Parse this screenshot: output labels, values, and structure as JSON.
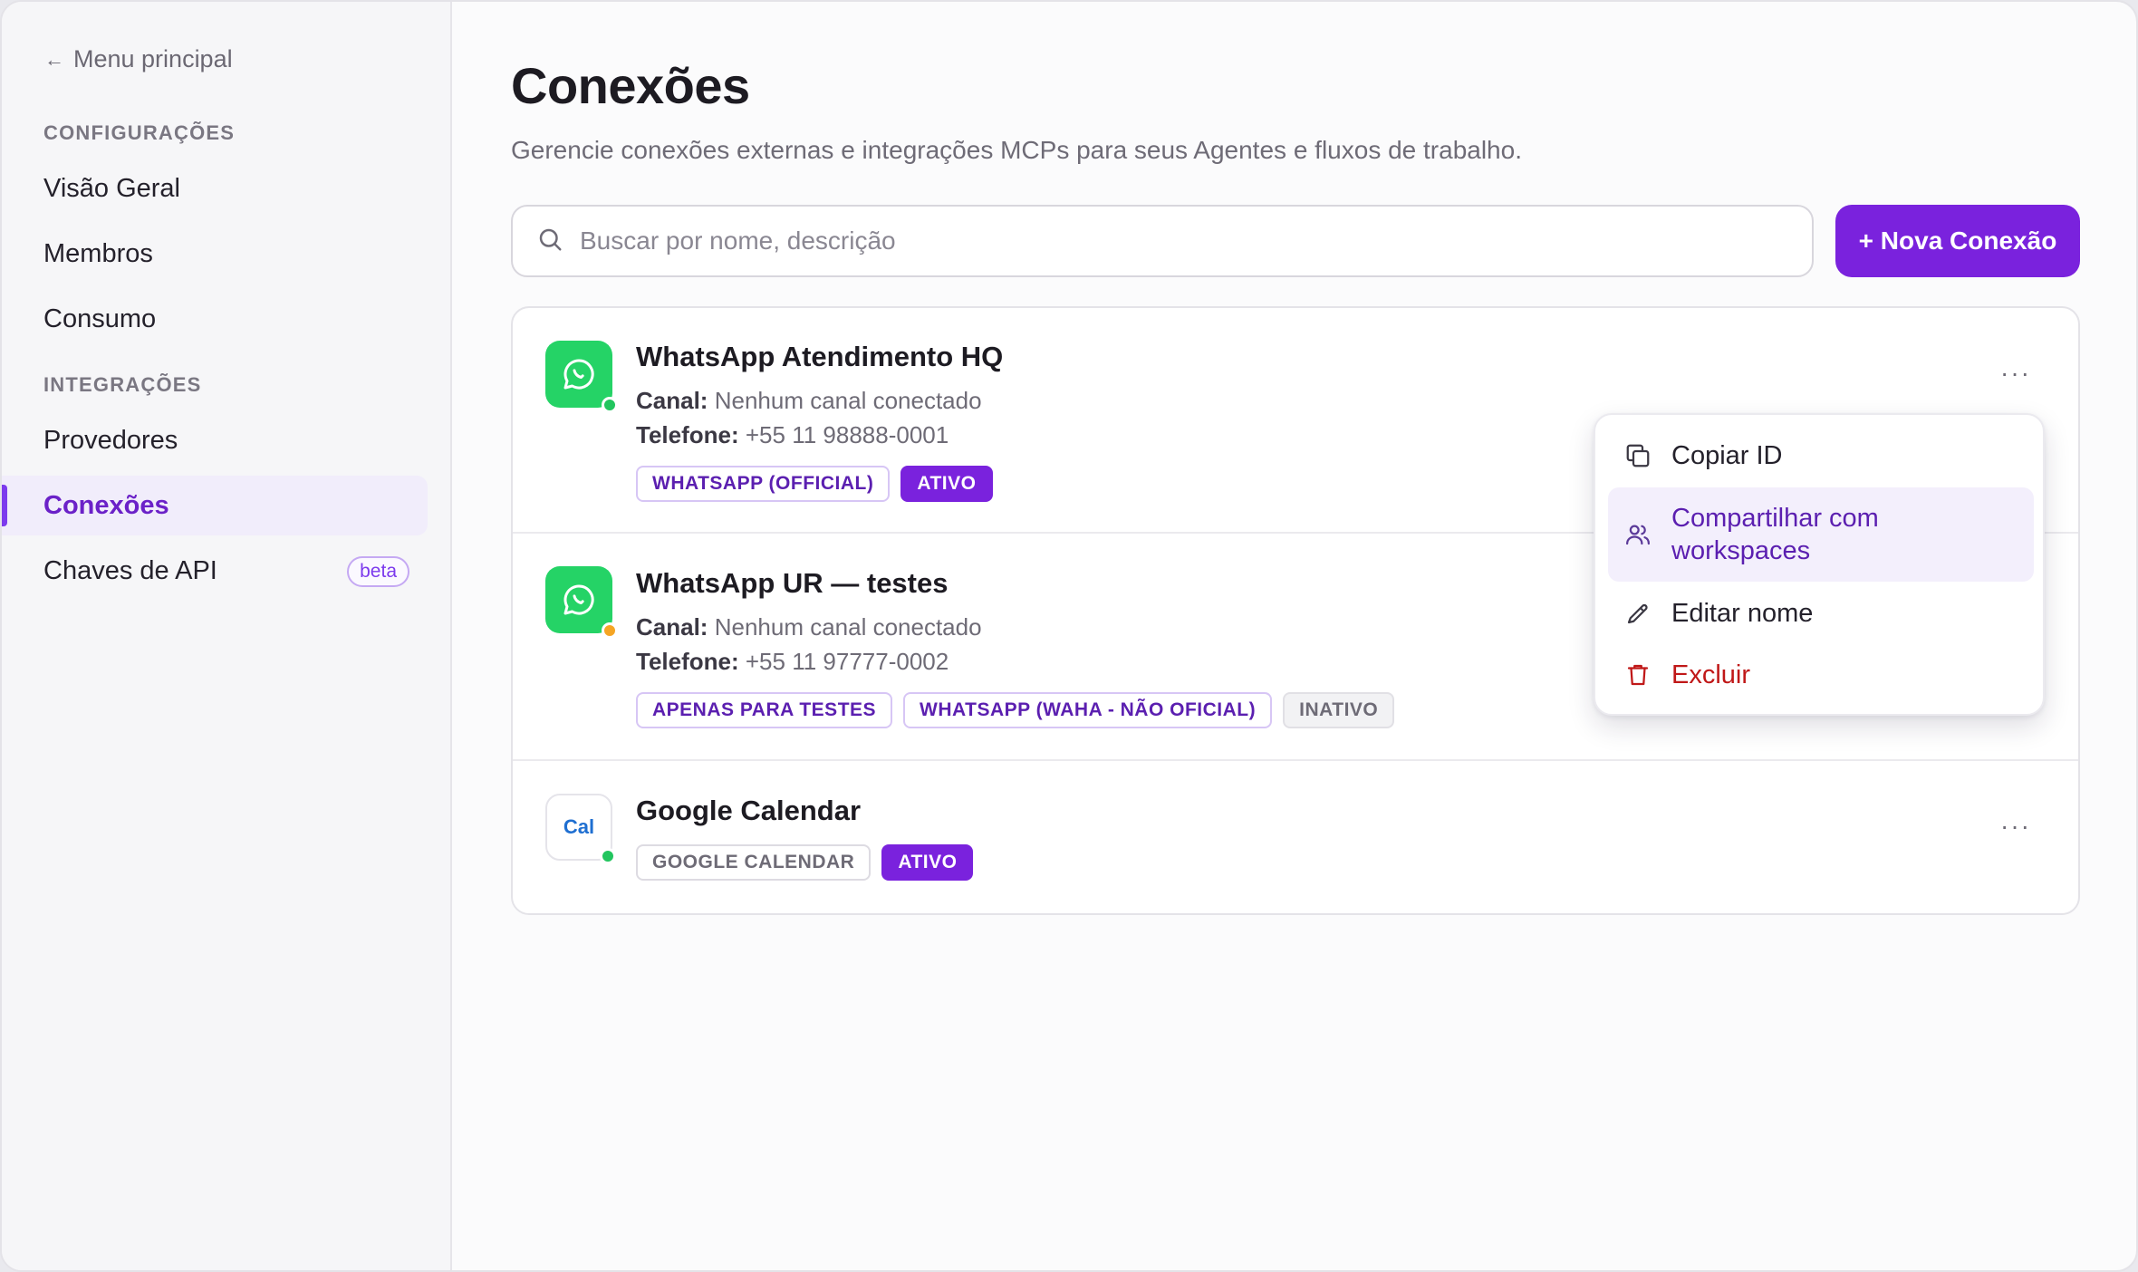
{
  "sidebar": {
    "back_label": "Menu principal",
    "section_config": "CONFIGURAÇÕES",
    "item_overview": "Visão Geral",
    "item_members": "Membros",
    "item_usage": "Consumo",
    "section_integrations": "INTEGRAÇÕES",
    "item_providers": "Provedores",
    "item_connections": "Conexões",
    "item_api_keys": "Chaves de API",
    "beta_badge": "beta"
  },
  "main": {
    "title": "Conexões",
    "subtitle": "Gerencie conexões externas e integrações MCPs para seus Agentes e fluxos de trabalho.",
    "search_placeholder": "Buscar por nome, descrição",
    "new_button": "+ Nova Conexão"
  },
  "connections": [
    {
      "name": "WhatsApp Atendimento HQ",
      "channel_label": "Canal:",
      "channel_value": "Nenhum canal conectado",
      "phone_label": "Telefone:",
      "phone_value": "+55 11 98888-0001",
      "tags": [
        "WHATSAPP (OFFICIAL)",
        "ATIVO"
      ],
      "status_color": "#22c55e"
    },
    {
      "name": "WhatsApp UR — testes",
      "channel_label": "Canal:",
      "channel_value": "Nenhum canal conectado",
      "phone_label": "Telefone:",
      "phone_value": "+55 11 97777-0002",
      "tags": [
        "APENAS PARA TESTES",
        "WHATSAPP (WAHA - NÃO OFICIAL)",
        "INATIVO"
      ],
      "status_color": "#f5a524"
    },
    {
      "name": "Google Calendar",
      "icon_text": "Cal",
      "tags": [
        "GOOGLE CALENDAR",
        "ATIVO"
      ],
      "status_color": "#22c55e"
    }
  ],
  "menu": {
    "copy_id": "Copiar ID",
    "share_line1": "Compartilhar com",
    "share_line2": "workspaces",
    "rename": "Editar nome",
    "delete": "Excluir"
  },
  "colors": {
    "accent": "#7a22dd",
    "whatsapp": "#25d366",
    "danger": "#c01818"
  },
  "icons": [
    "arrow-left-icon",
    "search-icon",
    "whatsapp-icon",
    "more-icon",
    "copy-icon",
    "users-icon",
    "pencil-icon",
    "trash-icon"
  ]
}
